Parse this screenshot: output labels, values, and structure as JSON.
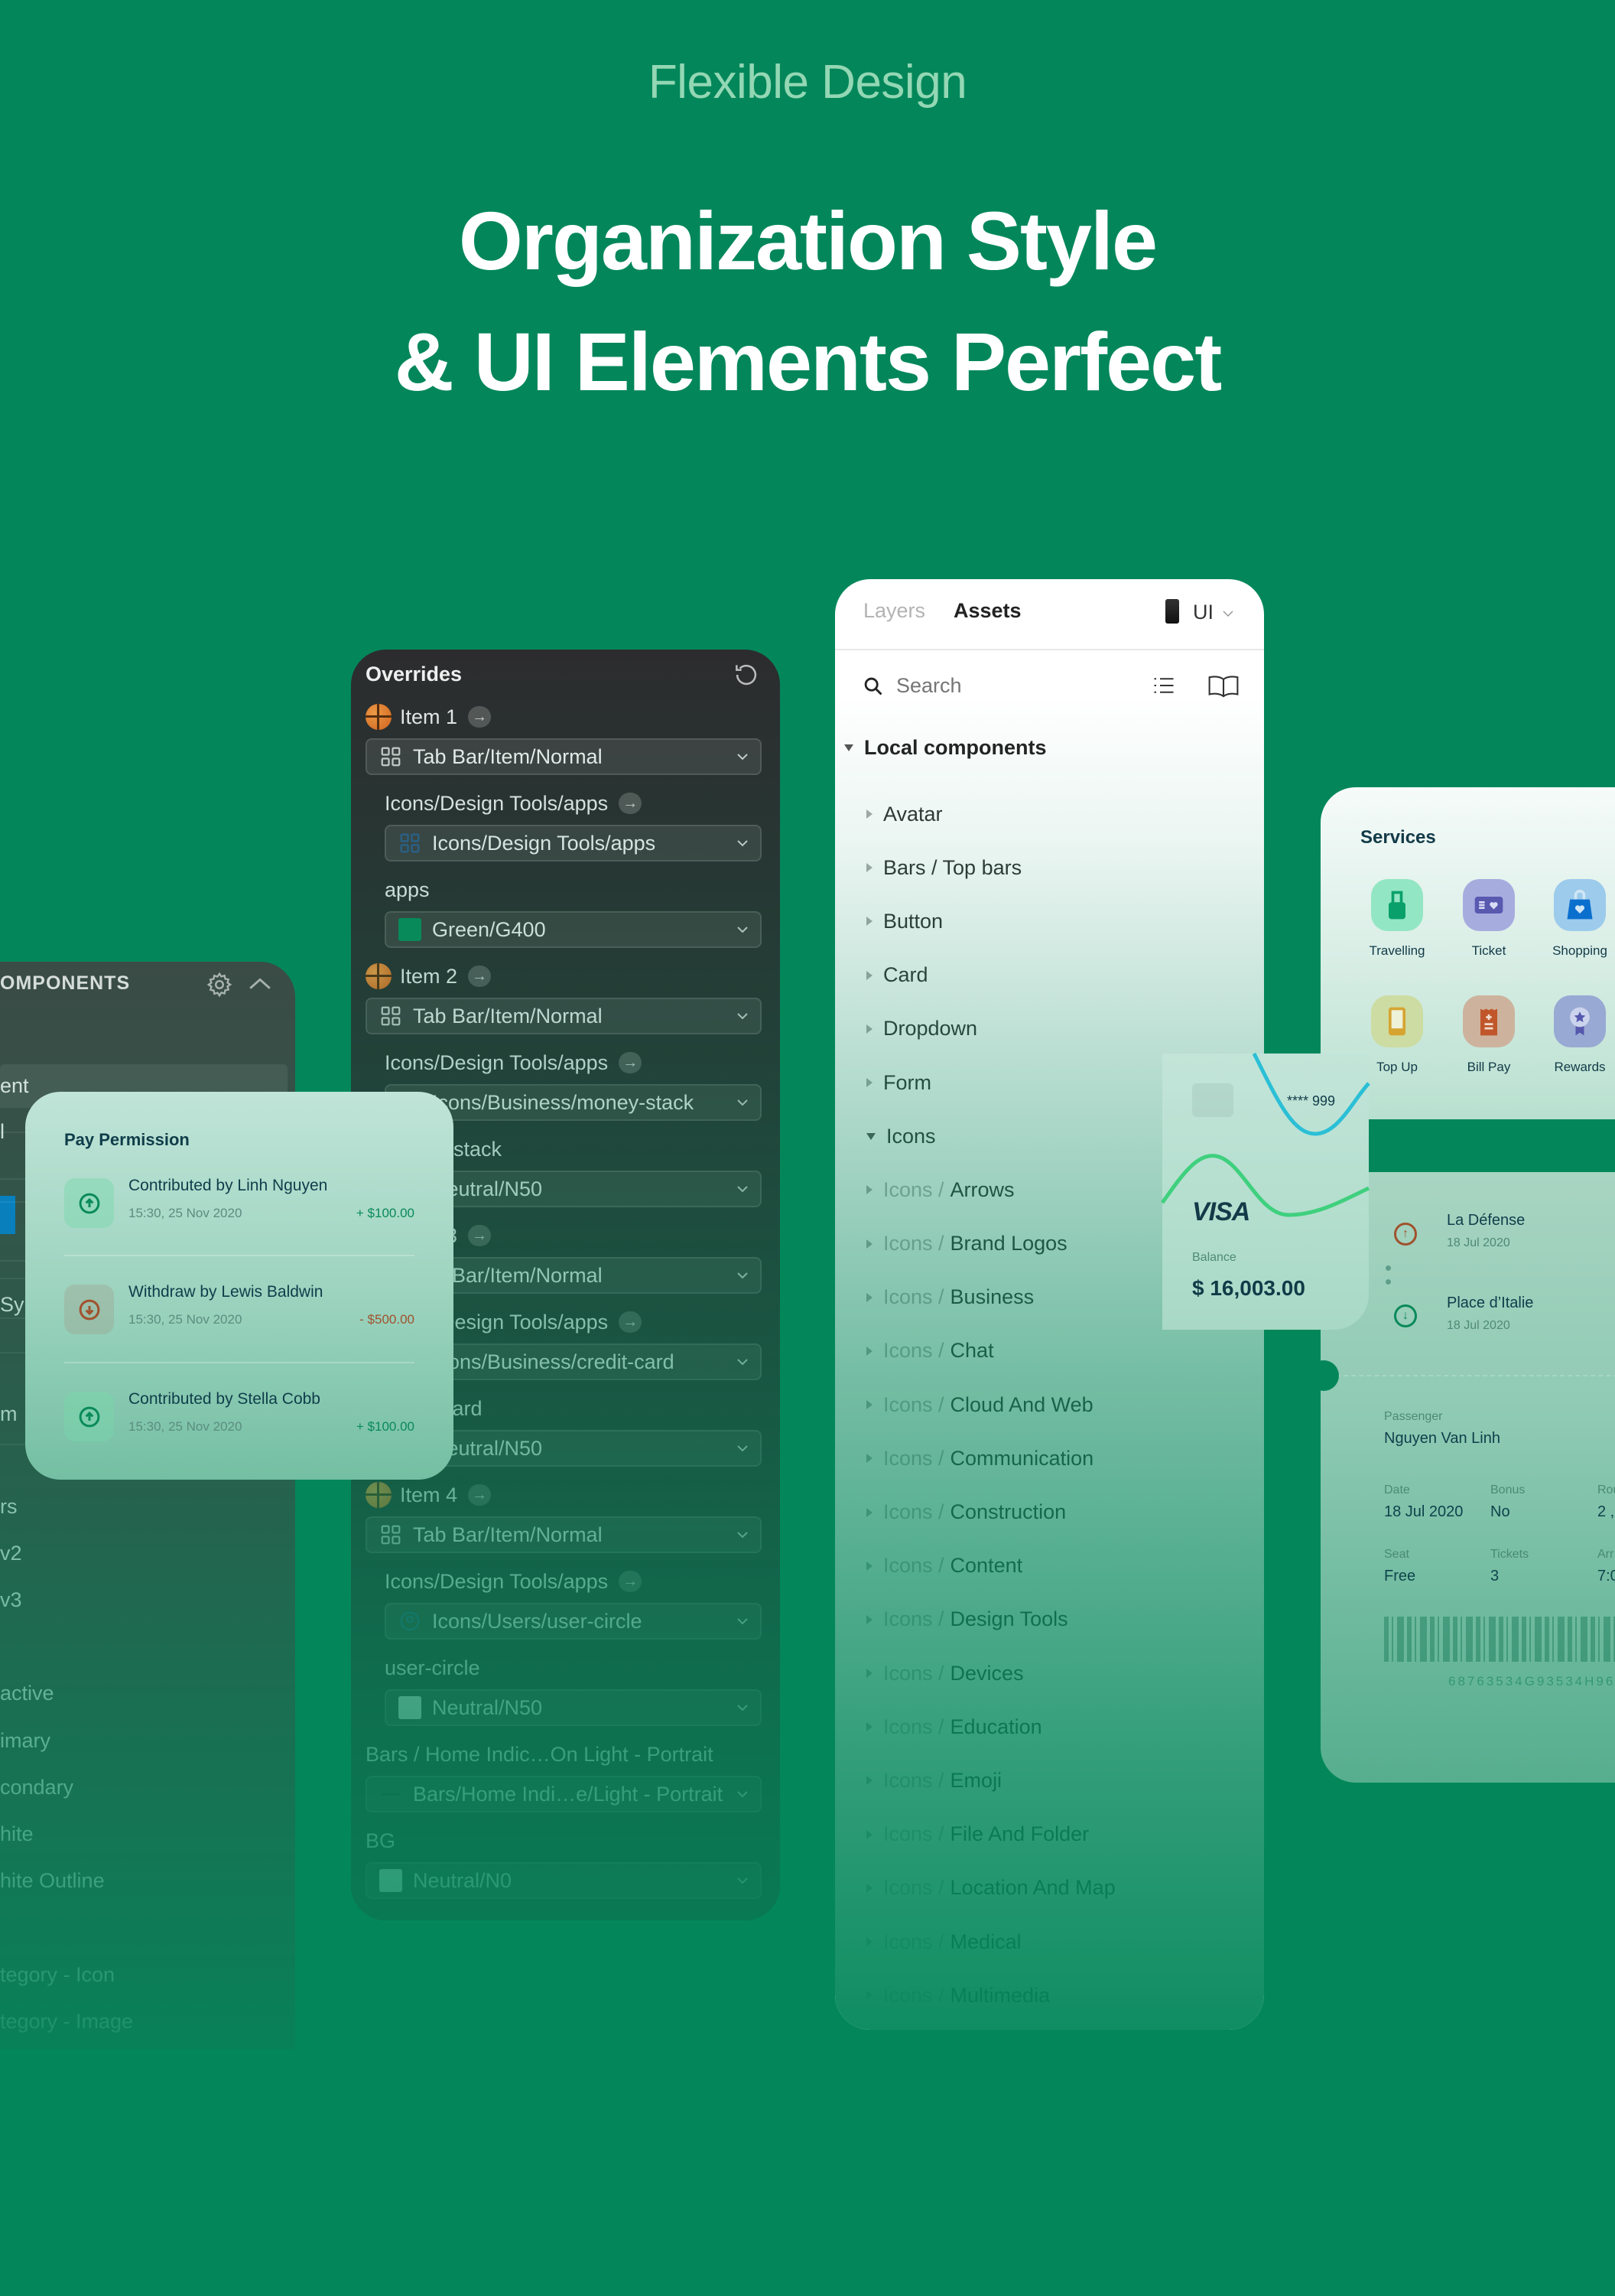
{
  "hero": {
    "eyebrow": "Flexible Design",
    "headline_line1": "Organization Style",
    "headline_line2": "& UI Elements Perfect"
  },
  "colors": {
    "background": "#03875a",
    "dark_panel": "#2c2c2e",
    "accent_green": "#0a8a5a",
    "withdraw_brown": "#a0522d",
    "text_dark": "#0f3d4a",
    "selection_blue": "#0a7fd0"
  },
  "components_panel": {
    "title": "OMPONENTS",
    "icons": [
      "gear-icon",
      "chevron-up-icon"
    ],
    "rows": [
      "ent",
      "l",
      "Sy",
      "m",
      "rs",
      "v2",
      "v3",
      "active",
      "imary",
      "condary",
      "hite",
      "hite Outline",
      "tegory - Icon",
      "tegory - Image"
    ]
  },
  "overrides": {
    "title": "Overrides",
    "reset_icon": "reset-icon",
    "rows": [
      {
        "type": "item",
        "label": "Item 1",
        "icon": "basketball-icon"
      },
      {
        "type": "dropdown",
        "icon": "grid-icon",
        "value": "Tab Bar/Item/Normal",
        "level": 0
      },
      {
        "type": "label",
        "label": "Icons/Design Tools/apps",
        "link": true,
        "level": 1
      },
      {
        "type": "dropdown",
        "icon": "apps-icon",
        "value": "Icons/Design Tools/apps",
        "level": 1
      },
      {
        "type": "label",
        "label": "apps",
        "level": 1
      },
      {
        "type": "dropdown",
        "swatch": "#0a8a5a",
        "value": "Green/G400",
        "level": 1
      },
      {
        "type": "item",
        "label": "Item 2",
        "icon": "basketball-icon"
      },
      {
        "type": "dropdown",
        "icon": "grid-icon",
        "value": "Tab Bar/Item/Normal",
        "level": 0
      },
      {
        "type": "label",
        "label": "Icons/Design Tools/apps",
        "link": true,
        "level": 1
      },
      {
        "type": "dropdown",
        "icon": "money-stack-icon",
        "value": "Icons/Business/money-stack",
        "level": 1
      },
      {
        "type": "label",
        "label": "money-stack",
        "level": 1
      },
      {
        "type": "dropdown",
        "swatch": "#e8eaea",
        "value": "Neutral/N50",
        "level": 1
      },
      {
        "type": "item",
        "label": "Item 3",
        "icon": "basketball-icon"
      },
      {
        "type": "dropdown",
        "icon": "grid-icon",
        "value": "Tab Bar/Item/Normal",
        "level": 0
      },
      {
        "type": "label",
        "label": "Icons/Design Tools/apps",
        "link": true,
        "level": 1
      },
      {
        "type": "dropdown",
        "icon": "credit-card-icon",
        "value": "Icons/Business/credit-card",
        "level": 1
      },
      {
        "type": "label",
        "label": "credit-card",
        "level": 1
      },
      {
        "type": "dropdown",
        "swatch": "#e8eaea",
        "value": "Neutral/N50",
        "level": 1
      },
      {
        "type": "item",
        "label": "Item 4",
        "icon": "basketball-icon"
      },
      {
        "type": "dropdown",
        "icon": "grid-icon",
        "value": "Tab Bar/Item/Normal",
        "level": 0
      },
      {
        "type": "label",
        "label": "Icons/Design Tools/apps",
        "link": true,
        "level": 1
      },
      {
        "type": "dropdown",
        "icon": "user-circle-icon",
        "value": "Icons/Users/user-circle",
        "level": 1
      },
      {
        "type": "label",
        "label": "user-circle",
        "level": 1
      },
      {
        "type": "dropdown",
        "swatch": "#e8eaea",
        "value": "Neutral/N50",
        "level": 1
      },
      {
        "type": "label",
        "label": "Bars / Home Indic…On Light - Portrait",
        "level": 0
      },
      {
        "type": "dropdown",
        "icon": "home-indicator-icon",
        "value": "Bars/Home Indi…e/Light - Portrait",
        "level": 0
      },
      {
        "type": "label",
        "label": "BG",
        "level": 0
      },
      {
        "type": "dropdown",
        "swatch": "#ffffff",
        "value": "Neutral/N0",
        "level": 0
      }
    ]
  },
  "assets": {
    "tabs": {
      "layers": "Layers",
      "assets": "Assets"
    },
    "active_tab": "Assets",
    "library": "UI",
    "search_placeholder": "Search",
    "section": "Local components",
    "items": [
      {
        "name": "Avatar"
      },
      {
        "name": "Bars / Top bars"
      },
      {
        "name": "Button"
      },
      {
        "name": "Card"
      },
      {
        "name": "Dropdown"
      },
      {
        "name": "Form"
      },
      {
        "name": "Icons",
        "expanded": true
      },
      {
        "prefix": "Icons /",
        "name": "Arrows"
      },
      {
        "prefix": "Icons /",
        "name": "Brand Logos"
      },
      {
        "prefix": "Icons /",
        "name": "Business"
      },
      {
        "prefix": "Icons /",
        "name": "Chat"
      },
      {
        "prefix": "Icons /",
        "name": "Cloud And Web"
      },
      {
        "prefix": "Icons /",
        "name": "Communication"
      },
      {
        "prefix": "Icons /",
        "name": "Construction"
      },
      {
        "prefix": "Icons /",
        "name": "Content"
      },
      {
        "prefix": "Icons /",
        "name": "Design Tools"
      },
      {
        "prefix": "Icons /",
        "name": "Devices"
      },
      {
        "prefix": "Icons /",
        "name": "Education"
      },
      {
        "prefix": "Icons /",
        "name": "Emoji"
      },
      {
        "prefix": "Icons /",
        "name": "File And Folder"
      },
      {
        "prefix": "Icons /",
        "name": "Location And Map"
      },
      {
        "prefix": "Icons /",
        "name": "Medical"
      },
      {
        "prefix": "Icons /",
        "name": "Multimedia"
      }
    ]
  },
  "pay_permission": {
    "title": "Pay Permission",
    "rows": [
      {
        "title": "Contributed by Linh Nguyen",
        "time": "15:30, 25 Nov 2020",
        "amount": "+ $100.00",
        "direction": "in"
      },
      {
        "title": "Withdraw by Lewis Baldwin",
        "time": "15:30, 25 Nov 2020",
        "amount": "- $500.00",
        "direction": "out"
      },
      {
        "title": "Contributed by Stella Cobb",
        "time": "15:30, 25 Nov 2020",
        "amount": "+ $100.00",
        "direction": "in"
      }
    ]
  },
  "card": {
    "masked_number": "**** 999",
    "brand": "VISA",
    "balance_label": "Balance",
    "balance": "$ 16,003.00"
  },
  "services": {
    "title": "Services",
    "items": [
      {
        "label": "Travelling",
        "icon": "luggage-icon",
        "bg": "#93e6c3",
        "fg": "#0aa06b"
      },
      {
        "label": "Ticket",
        "icon": "ticket-icon",
        "bg": "#a7acdf",
        "fg": "#5a59b0"
      },
      {
        "label": "Shopping",
        "icon": "shopping-bag-icon",
        "bg": "#9ccbeb",
        "fg": "#0b6fce"
      },
      {
        "label": "Top Up",
        "icon": "phone-icon",
        "bg": "#cddca2",
        "fg": "#d6a431"
      },
      {
        "label": "Bill Pay",
        "icon": "receipt-icon",
        "bg": "#cdb39d",
        "fg": "#c0562a"
      },
      {
        "label": "Rewards",
        "icon": "medal-icon",
        "bg": "#98a9d3",
        "fg": "#5558ad"
      }
    ]
  },
  "ticket": {
    "from": {
      "name": "La Défense",
      "date": "18 Jul 2020"
    },
    "to": {
      "name": "Place d’Italie",
      "date": "18 Jul 2020"
    },
    "passenger_label": "Passenger",
    "passenger": "Nguyen Van Linh",
    "fields": [
      {
        "label": "Date",
        "value": "18 Jul 2020"
      },
      {
        "label": "Bonus",
        "value": "No"
      },
      {
        "label": "Rou",
        "value": "2 ,"
      },
      {
        "label": "Seat",
        "value": "Free"
      },
      {
        "label": "Tickets",
        "value": "3"
      },
      {
        "label": "Arr",
        "value": "7:0"
      }
    ],
    "code": "68763534G93534H96"
  }
}
